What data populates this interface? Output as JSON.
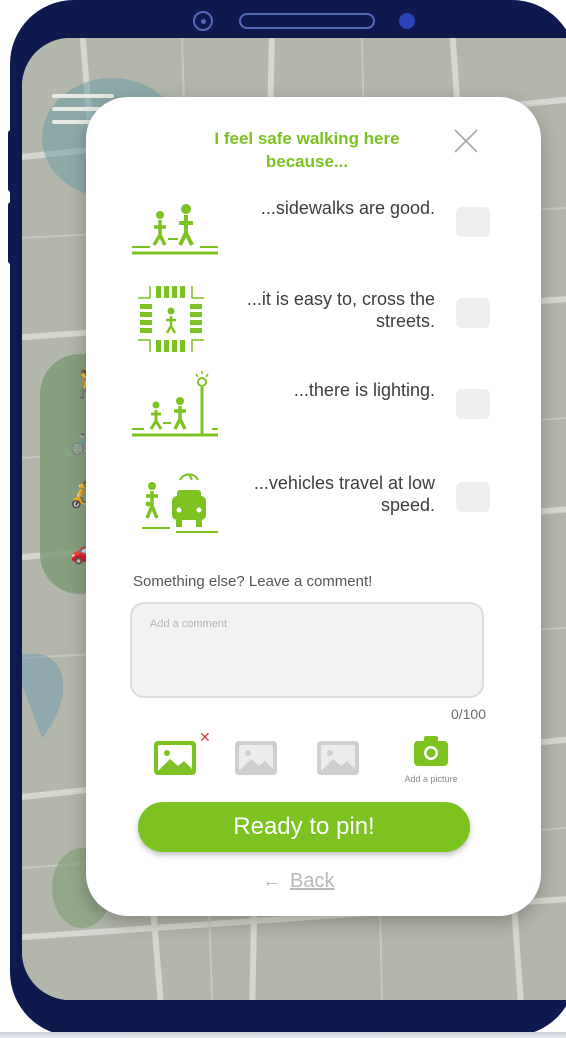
{
  "card": {
    "title": "I feel safe walking here because...",
    "close_icon": "close-icon"
  },
  "options": [
    {
      "icon": "sidewalk-pedestrians-icon",
      "text": "...sidewalks are good.",
      "checked": false
    },
    {
      "icon": "crosswalk-intersection-icon",
      "text": "...it is easy to, cross the streets.",
      "checked": false
    },
    {
      "icon": "streetlight-pedestrians-icon",
      "text": "...there is lighting.",
      "checked": false
    },
    {
      "icon": "slow-vehicle-pedestrians-icon",
      "text": "...vehicles travel at low speed.",
      "checked": false
    }
  ],
  "comment": {
    "label": "Something else? Leave a comment!",
    "placeholder": "Add a comment",
    "value": "",
    "counter": "0/100"
  },
  "pictures": {
    "slots": [
      {
        "icon": "image-icon",
        "filled": true
      },
      {
        "icon": "image-icon",
        "filled": false
      },
      {
        "icon": "image-icon",
        "filled": false
      }
    ],
    "remove_icon": "remove-x-icon",
    "add_label": "Add a picture",
    "add_icon": "camera-icon"
  },
  "actions": {
    "ready_label": "Ready to pin!",
    "back_label": "Back",
    "back_arrow": "←"
  },
  "colors": {
    "accent": "#7cc221",
    "frame": "#0e1a4d",
    "checkbox": "#eeeeee"
  }
}
